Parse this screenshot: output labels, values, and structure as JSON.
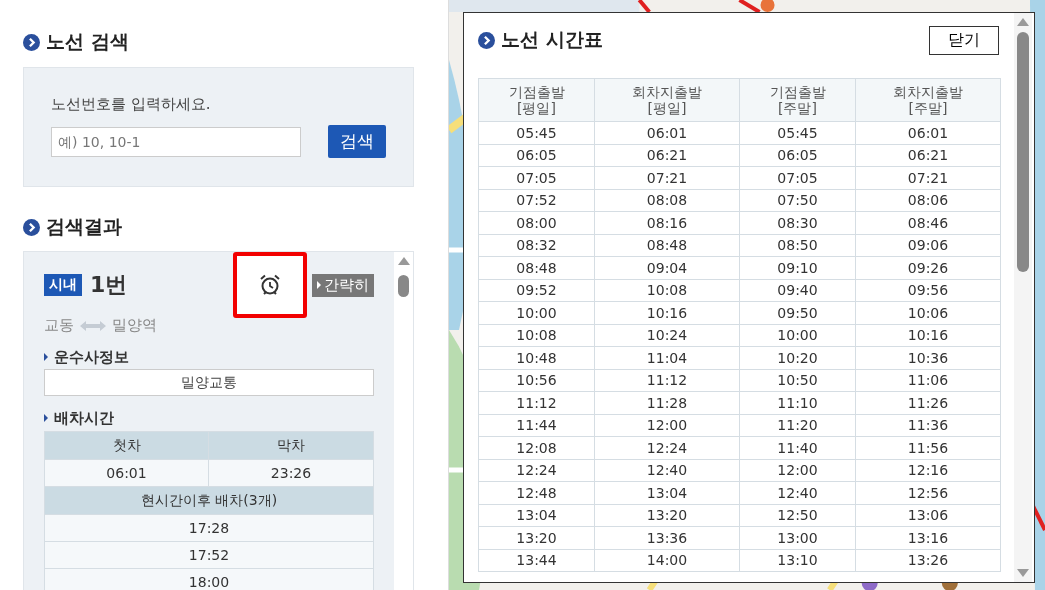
{
  "search_section": {
    "title": "노선 검색",
    "prompt": "노선번호를 입력하세요.",
    "input": {
      "placeholder": "예) 10, 10-1"
    },
    "button": "검색"
  },
  "results_section": {
    "title": "검색결과"
  },
  "route": {
    "type_badge": "시내",
    "number": "1번",
    "alarm_highlighted": true,
    "simple_button": "간략히",
    "origin": "교동",
    "destination": "밀양역",
    "operator_heading": "운수사정보",
    "operator": "밀양교통",
    "dispatch_heading": "배차시간",
    "first_last_columns": [
      "첫차",
      "막차"
    ],
    "first_last_values": [
      "06:01",
      "23:26"
    ],
    "upcoming_heading": "현시간이후 배차(3개)",
    "upcoming": [
      "17:28",
      "17:52",
      "18:00"
    ]
  },
  "timetable_window": {
    "title": "노선 시간표",
    "close_button": "닫기",
    "columns": [
      {
        "line1": "기점출발",
        "line2": "[평일]"
      },
      {
        "line1": "회차지출발",
        "line2": "[평일]"
      },
      {
        "line1": "기점출발",
        "line2": "[주말]"
      },
      {
        "line1": "회차지출발",
        "line2": "[주말]"
      }
    ],
    "rows": [
      [
        "05:45",
        "06:01",
        "05:45",
        "06:01"
      ],
      [
        "06:05",
        "06:21",
        "06:05",
        "06:21"
      ],
      [
        "07:05",
        "07:21",
        "07:05",
        "07:21"
      ],
      [
        "07:52",
        "08:08",
        "07:50",
        "08:06"
      ],
      [
        "08:00",
        "08:16",
        "08:30",
        "08:46"
      ],
      [
        "08:32",
        "08:48",
        "08:50",
        "09:06"
      ],
      [
        "08:48",
        "09:04",
        "09:10",
        "09:26"
      ],
      [
        "09:52",
        "10:08",
        "09:40",
        "09:56"
      ],
      [
        "10:00",
        "10:16",
        "09:50",
        "10:06"
      ],
      [
        "10:08",
        "10:24",
        "10:00",
        "10:16"
      ],
      [
        "10:48",
        "11:04",
        "10:20",
        "10:36"
      ],
      [
        "10:56",
        "11:12",
        "10:50",
        "11:06"
      ],
      [
        "11:12",
        "11:28",
        "11:10",
        "11:26"
      ],
      [
        "11:44",
        "12:00",
        "11:20",
        "11:36"
      ],
      [
        "12:08",
        "12:24",
        "11:40",
        "11:56"
      ],
      [
        "12:24",
        "12:40",
        "12:00",
        "12:16"
      ],
      [
        "12:48",
        "13:04",
        "12:40",
        "12:56"
      ],
      [
        "13:04",
        "13:20",
        "12:50",
        "13:06"
      ],
      [
        "13:20",
        "13:36",
        "13:00",
        "13:16"
      ],
      [
        "13:44",
        "14:00",
        "13:10",
        "13:26"
      ]
    ]
  }
}
